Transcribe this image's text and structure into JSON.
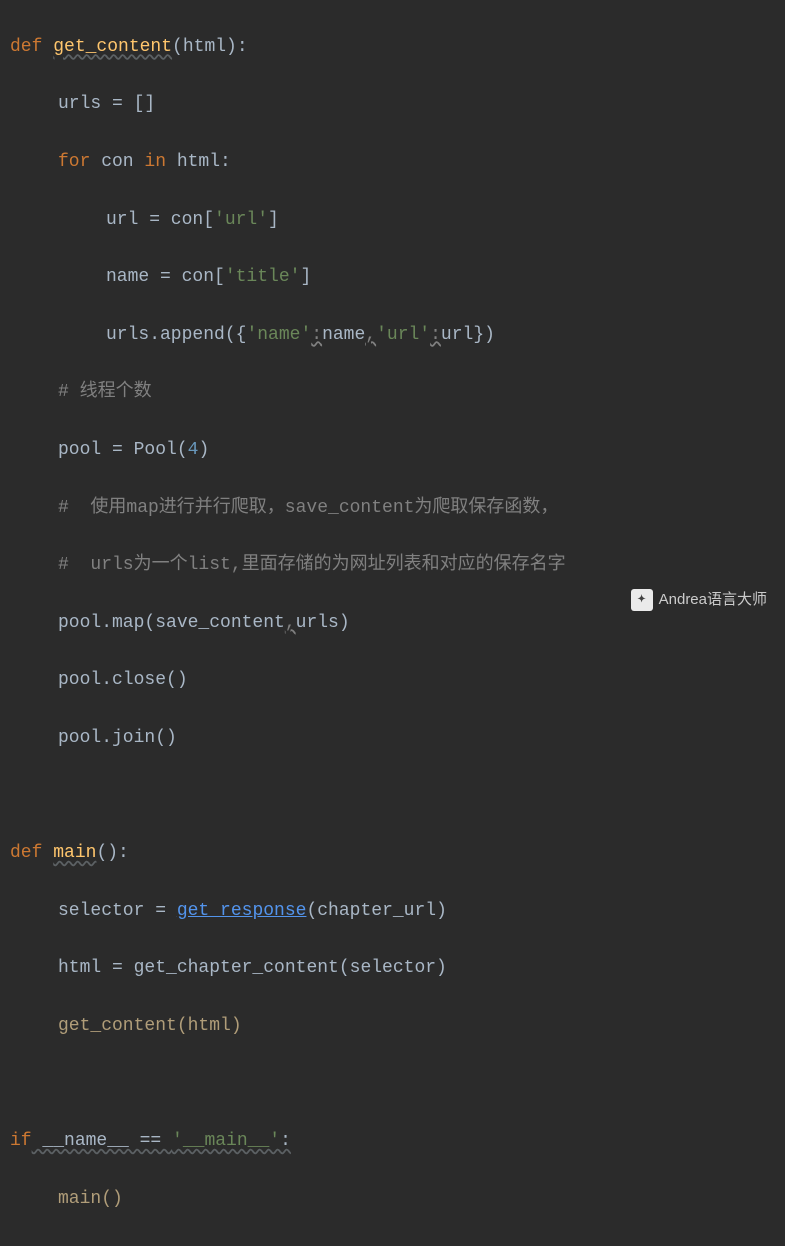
{
  "code": {
    "l1": {
      "def": "def",
      "name": "get_content",
      "args": "(html)",
      "colon": ":"
    },
    "l2": {
      "text": "urls = []"
    },
    "l3": {
      "for": "for",
      "mid": " con ",
      "in": "in",
      "tail": " html:"
    },
    "l4": {
      "lhs": "url = con[",
      "str": "'url'",
      "rhs": "]"
    },
    "l5": {
      "lhs": "name = con[",
      "str": "'title'",
      "rhs": "]"
    },
    "l6": {
      "a": "urls.append({",
      "k1": "'name'",
      "c1": ":",
      "v1": "name",
      "sep": ",",
      "k2": "'url'",
      "c2": ":",
      "v2": "url",
      "end": "})"
    },
    "l7": {
      "text": "# 线程个数"
    },
    "l8": {
      "a": "pool = Pool(",
      "n": "4",
      "b": ")"
    },
    "l9": {
      "text": "#  使用map进行并行爬取，save_content为爬取保存函数，"
    },
    "l10": {
      "text": "#  urls为一个list,里面存储的为网址列表和对应的保存名字"
    },
    "l11": {
      "a": "pool.map(save_content",
      "sep": ",",
      "b": "urls)"
    },
    "l12": {
      "text": "pool.close()"
    },
    "l13": {
      "text": "pool.join()"
    },
    "l14": {
      "def": "def",
      "name": "main",
      "args": "()",
      "colon": ":"
    },
    "l15": {
      "a": "selector = ",
      "fn": "get_response",
      "b": "(chapter_url)"
    },
    "l16": {
      "text": "html = get_chapter_content(selector)"
    },
    "l17": {
      "text": "get_content(html)"
    },
    "l18": {
      "if": "if",
      "a": " __name__ == ",
      "str": "'__main__'",
      "colon": ":"
    },
    "l19": {
      "text": "main()"
    }
  },
  "watermark": {
    "text": "Andrea语言大师"
  }
}
